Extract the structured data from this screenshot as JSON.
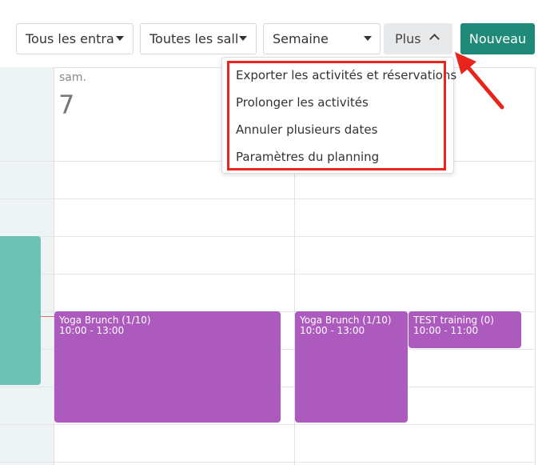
{
  "toolbar": {
    "trainer_filter": "Tous les entraîneurs",
    "room_filter": "Toutes les salles",
    "view_select": "Semaine",
    "more_button": "Plus",
    "new_button": "Nouveau"
  },
  "calendar": {
    "day_name": "sam.",
    "day_number": "7",
    "events": [
      {
        "title": "Yoga Brunch (1/10)",
        "time": "10:00 - 13:00"
      },
      {
        "title": "Yoga Brunch (1/10)",
        "time": "10:00 - 13:00"
      },
      {
        "title": "TEST training (0)",
        "time": "10:00 - 11:00"
      }
    ]
  },
  "more_menu": {
    "items": [
      "Exporter les activités et réservations",
      "Prolonger les activités",
      "Annuler plusieurs dates",
      "Paramètres du planning"
    ]
  },
  "colors": {
    "primary": "#1f8a78",
    "event_purple": "#ad5abe",
    "event_teal": "#6cc2b3",
    "annotation_red": "#e8241c"
  }
}
